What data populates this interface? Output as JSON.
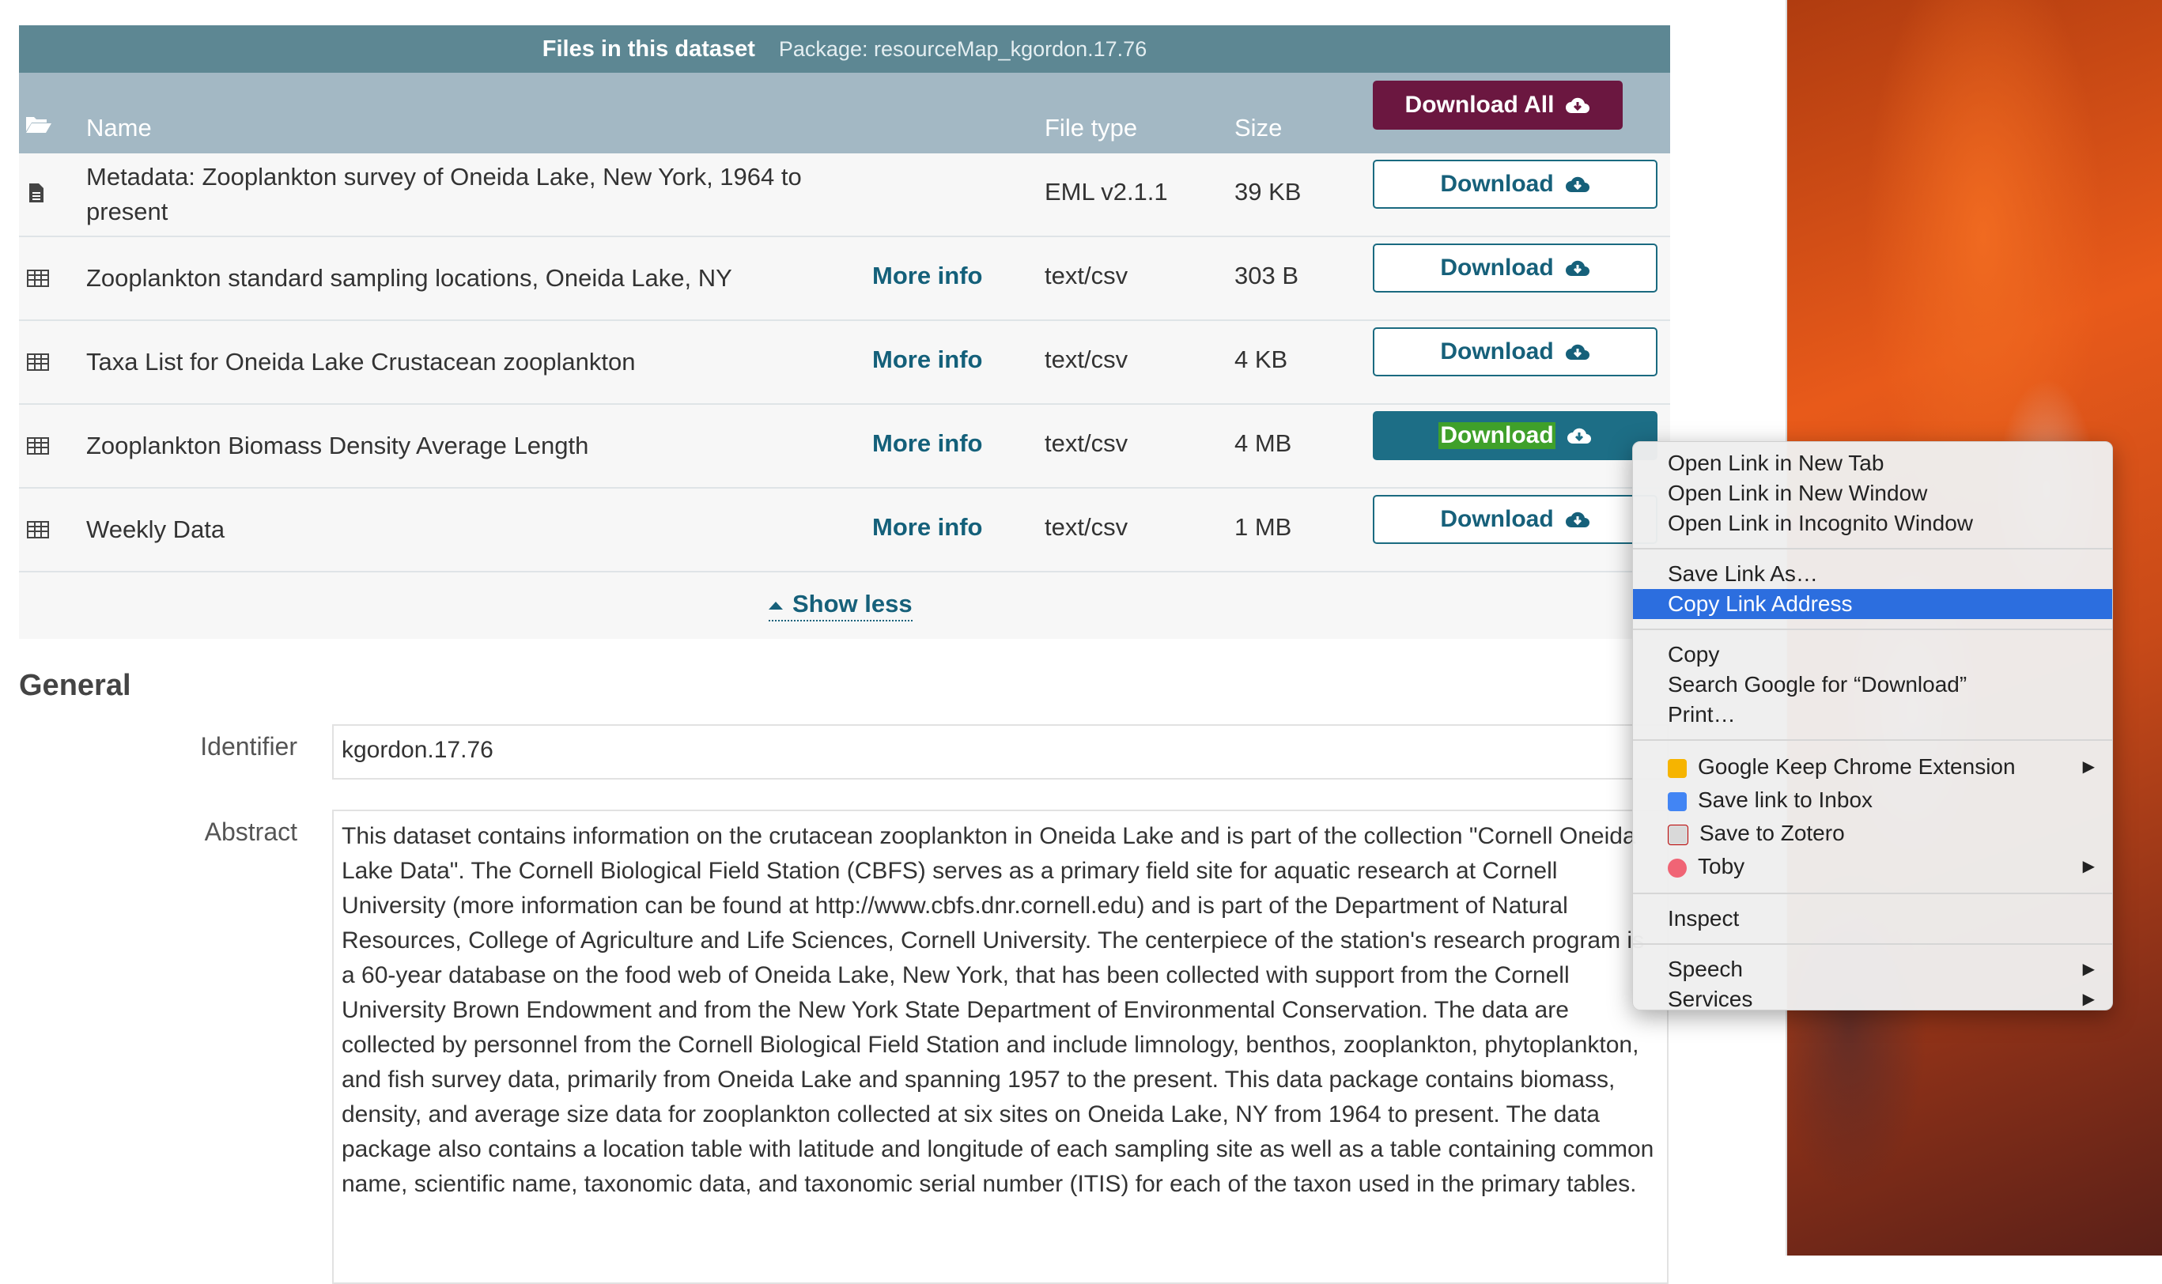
{
  "files_panel": {
    "title": "Files in this dataset",
    "package": "Package: resourceMap_kgordon.17.76",
    "columns": {
      "name": "Name",
      "file_type": "File type",
      "size": "Size"
    },
    "download_all_label": "Download All",
    "download_label": "Download",
    "more_info_label": "More info",
    "rows": [
      {
        "name": "Metadata: Zooplankton survey of Oneida Lake, New York, 1964 to present",
        "more_info": "",
        "type": "EML v2.1.1",
        "size": "39 KB",
        "icon": "document-icon"
      },
      {
        "name": "Zooplankton standard sampling locations, Oneida Lake, NY",
        "more_info": "More info",
        "type": "text/csv",
        "size": "303 B",
        "icon": "table-icon"
      },
      {
        "name": "Taxa List for Oneida Lake Crustacean zooplankton",
        "more_info": "More info",
        "type": "text/csv",
        "size": "4 KB",
        "icon": "table-icon"
      },
      {
        "name": "Zooplankton Biomass Density Average Length",
        "more_info": "More info",
        "type": "text/csv",
        "size": "4 MB",
        "icon": "table-icon"
      },
      {
        "name": "Weekly Data",
        "more_info": "More info",
        "type": "text/csv",
        "size": "1 MB",
        "icon": "table-icon"
      }
    ],
    "show_less": "Show less"
  },
  "general": {
    "heading": "General",
    "identifier_label": "Identifier",
    "identifier_value": "kgordon.17.76",
    "abstract_label": "Abstract",
    "abstract_value": "This dataset contains information on the crutacean zooplankton in Oneida Lake and is part of the collection \"Cornell Oneida Lake Data\". The Cornell Biological Field Station (CBFS) serves as a primary field site for aquatic research at Cornell University (more information can be found at http://www.cbfs.dnr.cornell.edu) and is part of the Department of Natural Resources, College of Agriculture and Life Sciences, Cornell University. The centerpiece of the station's research program is a 60-year database on the food web of Oneida Lake, New York, that has been collected with support from the Cornell University Brown Endowment and from the New York State Department of Environmental Conservation. The data are collected by personnel from the Cornell Biological Field Station and include limnology, benthos, zooplankton, phytoplankton, and fish survey data, primarily from Oneida Lake and spanning 1957 to the present. This data package contains biomass, density, and average size data for zooplankton collected at six sites on Oneida Lake, NY from 1964 to present. The data package also contains a location table with latitude and longitude of each sampling site as well as a table containing common name, scientific name, taxonomic data, and taxonomic serial number (ITIS) for each of the taxon used in the primary tables."
  },
  "context_menu": {
    "open_new_tab": "Open Link in New Tab",
    "open_new_window": "Open Link in New Window",
    "open_incognito": "Open Link in Incognito Window",
    "save_link_as": "Save Link As…",
    "copy_link_address": "Copy Link Address",
    "copy": "Copy",
    "search_google": "Search Google for “Download”",
    "print": "Print…",
    "google_keep": "Google Keep Chrome Extension",
    "save_to_inbox": "Save link to Inbox",
    "save_to_zotero": "Save to Zotero",
    "toby": "Toby",
    "inspect": "Inspect",
    "speech": "Speech",
    "services": "Services",
    "submenu_arrow": "▶"
  },
  "colors": {
    "header_bar": "#5d8793",
    "column_header": "#a3b8c4",
    "download_all": "#6b1740",
    "download_active": "#1d6e86",
    "link_teal": "#16607a",
    "menu_highlight": "#2c6edf"
  }
}
